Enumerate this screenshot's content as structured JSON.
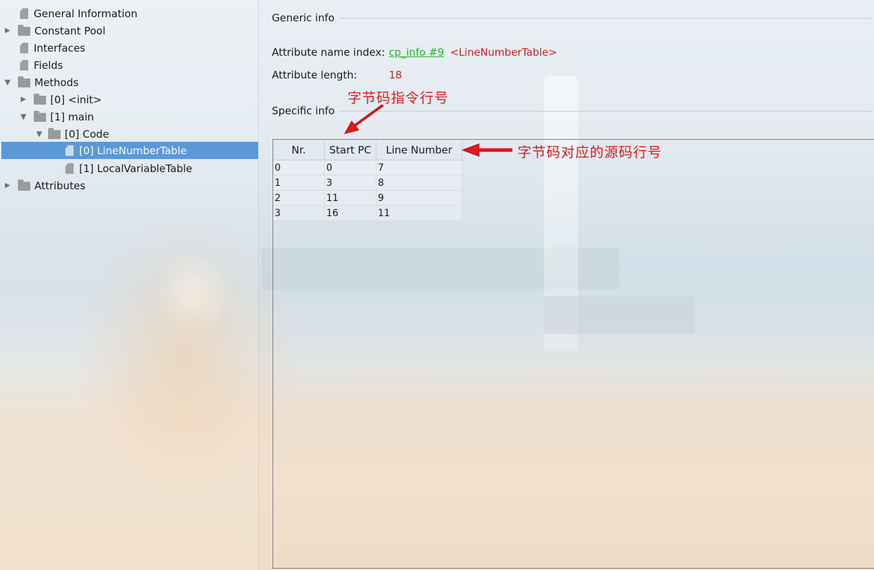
{
  "tree": {
    "items": [
      {
        "label": "General Information",
        "kind": "file",
        "arrow": ""
      },
      {
        "label": "Constant Pool",
        "kind": "folder",
        "arrow": "collapsed"
      },
      {
        "label": "Interfaces",
        "kind": "file",
        "arrow": ""
      },
      {
        "label": "Fields",
        "kind": "file",
        "arrow": ""
      },
      {
        "label": "Methods",
        "kind": "folder",
        "arrow": "expanded"
      },
      {
        "label": "[0] <init>",
        "kind": "folder",
        "arrow": "collapsed"
      },
      {
        "label": "[1] main",
        "kind": "folder",
        "arrow": "expanded"
      },
      {
        "label": "[0] Code",
        "kind": "folder",
        "arrow": "expanded"
      },
      {
        "label": "[0] LineNumberTable",
        "kind": "file",
        "arrow": "",
        "selected": true
      },
      {
        "label": "[1] LocalVariableTable",
        "kind": "file",
        "arrow": ""
      },
      {
        "label": "Attributes",
        "kind": "folder",
        "arrow": "collapsed"
      }
    ]
  },
  "detail": {
    "generic_title": "Generic info",
    "name_index_label": "Attribute name index:",
    "name_index_link": "cp_info #9",
    "name_index_value": "<LineNumberTable>",
    "length_label": "Attribute length:",
    "length_value": "18",
    "specific_title": "Specific info",
    "table": {
      "headers": [
        "Nr.",
        "Start PC",
        "Line Number"
      ],
      "rows": [
        [
          "0",
          "0",
          "7"
        ],
        [
          "1",
          "3",
          "8"
        ],
        [
          "2",
          "11",
          "9"
        ],
        [
          "3",
          "16",
          "11"
        ]
      ]
    }
  },
  "annotations": {
    "start_pc_note": "字节码指令行号",
    "line_number_note": "字节码对应的源码行号",
    "color": "#e0191b"
  },
  "colors": {
    "selection": "#5c97d6",
    "link": "#26b32e",
    "value_red": "#d22020"
  }
}
